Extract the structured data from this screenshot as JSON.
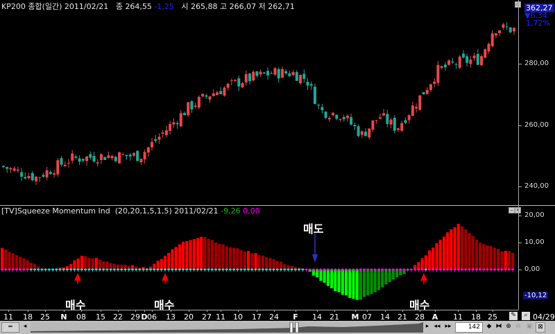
{
  "header": {
    "symbol": "KP200 종합(일간)",
    "date": "2011/02/21",
    "close_label": "종",
    "close": "264,55",
    "change": "-1,25",
    "open_label": "시",
    "open": "265,88",
    "high_label": "고",
    "high": "266,07",
    "low_label": "저",
    "low": "262,71"
  },
  "price_readout": {
    "value": "362,27",
    "change": "6,34",
    "percent": "1,72%"
  },
  "price_axis": {
    "labels": [
      "280,00",
      "260,00",
      "240,00"
    ]
  },
  "indicator": {
    "title": "[TV]Squeeze Momentum Ind",
    "params": "(20,20,1,5,1,5)",
    "date": "2011/02/21",
    "value1": "-9,26",
    "value2": "0,00",
    "axis": [
      "20,00",
      "10,00",
      "0,00"
    ],
    "current": "-10,12"
  },
  "annotations": {
    "buy": "매수",
    "sell": "매도"
  },
  "time_axis": [
    "11",
    "18",
    "25",
    "N",
    "08",
    "15",
    "22",
    "29",
    "D",
    "06",
    "13",
    "20",
    "27",
    "11",
    "10",
    "17",
    "24",
    "F",
    "14",
    "21",
    "M",
    "07",
    "14",
    "21",
    "28",
    "A",
    "11",
    "18",
    "25"
  ],
  "end_date": "04/29",
  "bar_count": "142",
  "colors": {
    "up": "#e84848",
    "down": "#20a898",
    "mom_up": "#ff0000",
    "mom_down": "#a00000",
    "neg_down": "#00ff00",
    "neg_up": "#009000"
  }
}
